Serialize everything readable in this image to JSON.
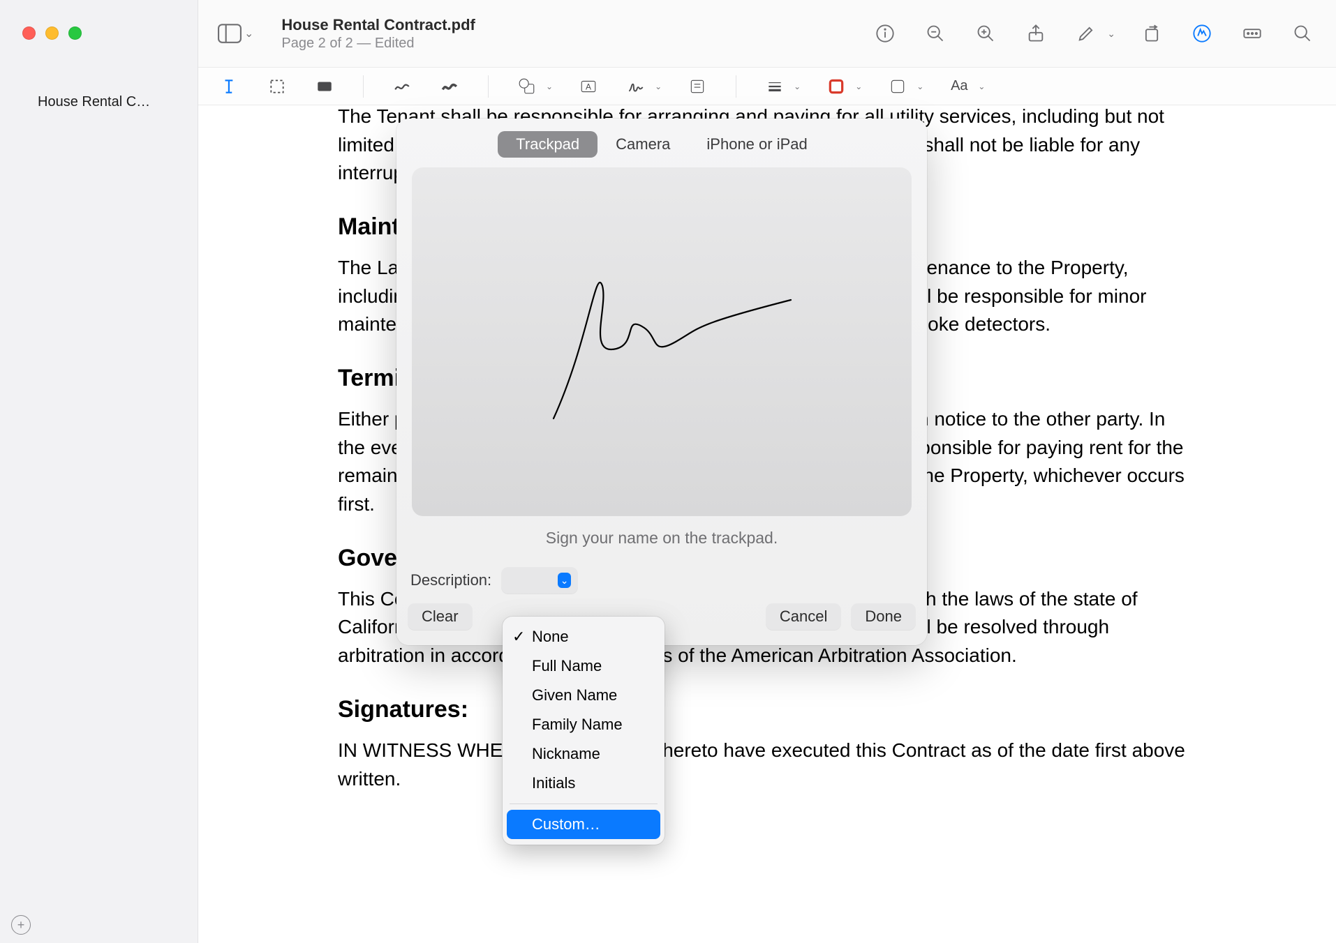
{
  "window": {
    "doc_title": "House Rental Contract.pdf",
    "doc_sub": "Page 2 of 2 — Edited"
  },
  "sidebar": {
    "items": [
      "House Rental C…"
    ]
  },
  "doc": {
    "p1": "The Tenant shall be responsible for arranging and paying for all utility services, including but not limited to electricity, gas, water, and internet services. The Landlord shall not be liable for any interruption or failure of utility services.",
    "h1": "Maintenance and Repairs:",
    "p2": "The Landlord shall be responsible for all structural repairs and maintenance to the Property, including plumbing, heating, and electrical systems. The Tenant shall be responsible for minor maintenance tasks, such as replacing light bulbs and batteries in smoke detectors.",
    "h2": "Termination:",
    "p3": "Either party may terminate this Contract upon thirty (30) days written notice to the other party. In the event of early termination by the Tenant, the Tenant shall be responsible for paying rent for the remainder of the Lease Term or until the Landlord is able to re-rent the Property, whichever occurs first.",
    "h3": "Governing Law:",
    "p4": "This Contract shall be governed by and construed in accordance with the laws of the state of California. Any disputes arising under or related to this Contract shall be resolved through arbitration in accordance with the rules of the American Arbitration Association.",
    "h4": "Signatures:",
    "p5": "IN WITNESS WHEREOF, the parties hereto have executed this Contract as of the date first above written."
  },
  "popover": {
    "tabs": {
      "trackpad": "Trackpad",
      "camera": "Camera",
      "iphone": "iPhone or iPad"
    },
    "hint": "Sign your name on the trackpad.",
    "description_label": "Description:",
    "clear": "Clear",
    "cancel": "Cancel",
    "done": "Done"
  },
  "dropdown": {
    "none": "None",
    "full_name": "Full Name",
    "given_name": "Given Name",
    "family_name": "Family Name",
    "nickname": "Nickname",
    "initials": "Initials",
    "custom": "Custom…"
  },
  "toolbar_icons": {
    "info": "info-icon",
    "zoom_out": "zoom-out-icon",
    "zoom_in": "zoom-in-icon",
    "share": "share-icon",
    "highlight": "highlight-icon",
    "rotate": "rotate-icon",
    "markup": "markup-icon",
    "form": "form-field-icon",
    "search": "search-icon"
  }
}
